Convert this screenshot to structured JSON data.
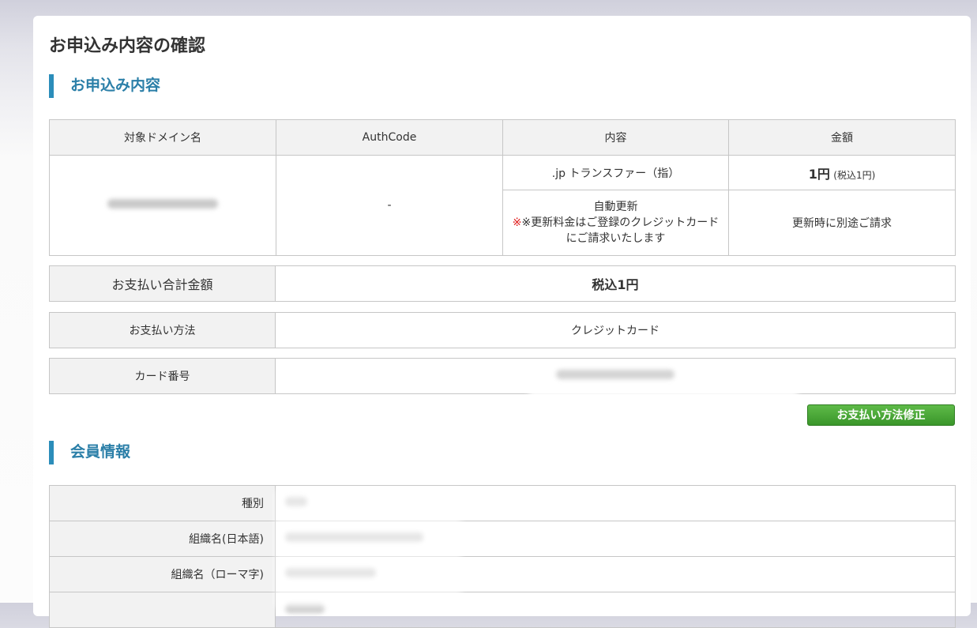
{
  "page_title": "お申込み内容の確認",
  "section_order": {
    "title": "お申込み内容"
  },
  "order_table": {
    "headers": [
      "対象ドメイン名",
      "AuthCode",
      "内容",
      "金額"
    ],
    "authcode": "-",
    "rows": [
      {
        "content": ".jp トランスファー（指）",
        "amount": "1円",
        "amount_note": "(税込1円)"
      },
      {
        "content_line1": "自動更新",
        "content_note": "※更新料金はご登録のクレジットカード",
        "content_line3": "にご請求いたします",
        "amount": "更新時に別途ご請求"
      }
    ]
  },
  "total": {
    "label": "お支払い合計金額",
    "value": "税込1円"
  },
  "payment_method": {
    "label": "お支払い方法",
    "value": "クレジットカード"
  },
  "card_number": {
    "label": "カード番号"
  },
  "edit_payment_button": "お支払い方法修正",
  "section_member": {
    "title": "会員情報"
  },
  "member_table": {
    "rows": [
      {
        "label": "種別"
      },
      {
        "label": "組織名(日本語)"
      },
      {
        "label": "組織名（ローマ字)"
      },
      {
        "label": ""
      }
    ]
  }
}
